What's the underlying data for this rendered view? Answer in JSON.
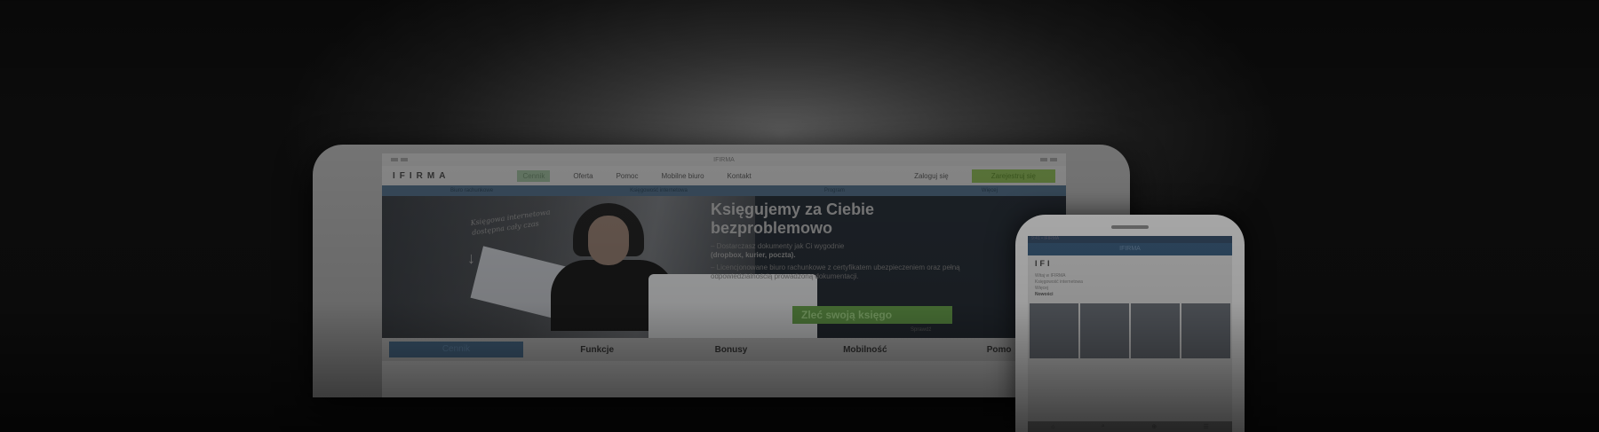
{
  "tablet": {
    "status_center": "IFIRMA",
    "logo": "IFIRMA",
    "nav": [
      "Cennik",
      "Oferta",
      "Pomoc",
      "Mobilne biuro",
      "Kontakt"
    ],
    "login": "Zaloguj się",
    "register": "Zarejestruj się",
    "subnav": [
      "Biuro rachunkowe",
      "Księgowość internetowa",
      "Program",
      "Więcej"
    ],
    "handwriting": "Księgowa internetowa dostępna cały czas",
    "hero_title_line1": "Księgujemy za Ciebie",
    "hero_title_line2": "bezproblemowo",
    "hero_item1_text": "Dostarczasz dokumenty jak Ci wygodnie",
    "hero_item1_bold": "(dropbox, kurier, poczta).",
    "hero_item2_text": "Licencjonowane biuro rachunkowe z certyfikatem ubezpieczeniem oraz pełną odpowiedzialnością prowadzoną dokumentacji.",
    "cta": "Zleć swoją księgo",
    "cta_sub": "Sprawdź",
    "tabs": [
      "Cennik",
      "Funkcje",
      "Bonusy",
      "Mobilność",
      "Pomo"
    ]
  },
  "phone": {
    "status": "9:41 • IFIRMA",
    "title": "IFIRMA",
    "logo": "IFI",
    "heading": "Witaj w IFIRMA",
    "line1": "Księgowość internetowa",
    "line2": "Więcej",
    "bold_label": "Nowości",
    "footer_icons": [
      "⌂",
      "⌕",
      "⊕",
      "☰"
    ]
  }
}
